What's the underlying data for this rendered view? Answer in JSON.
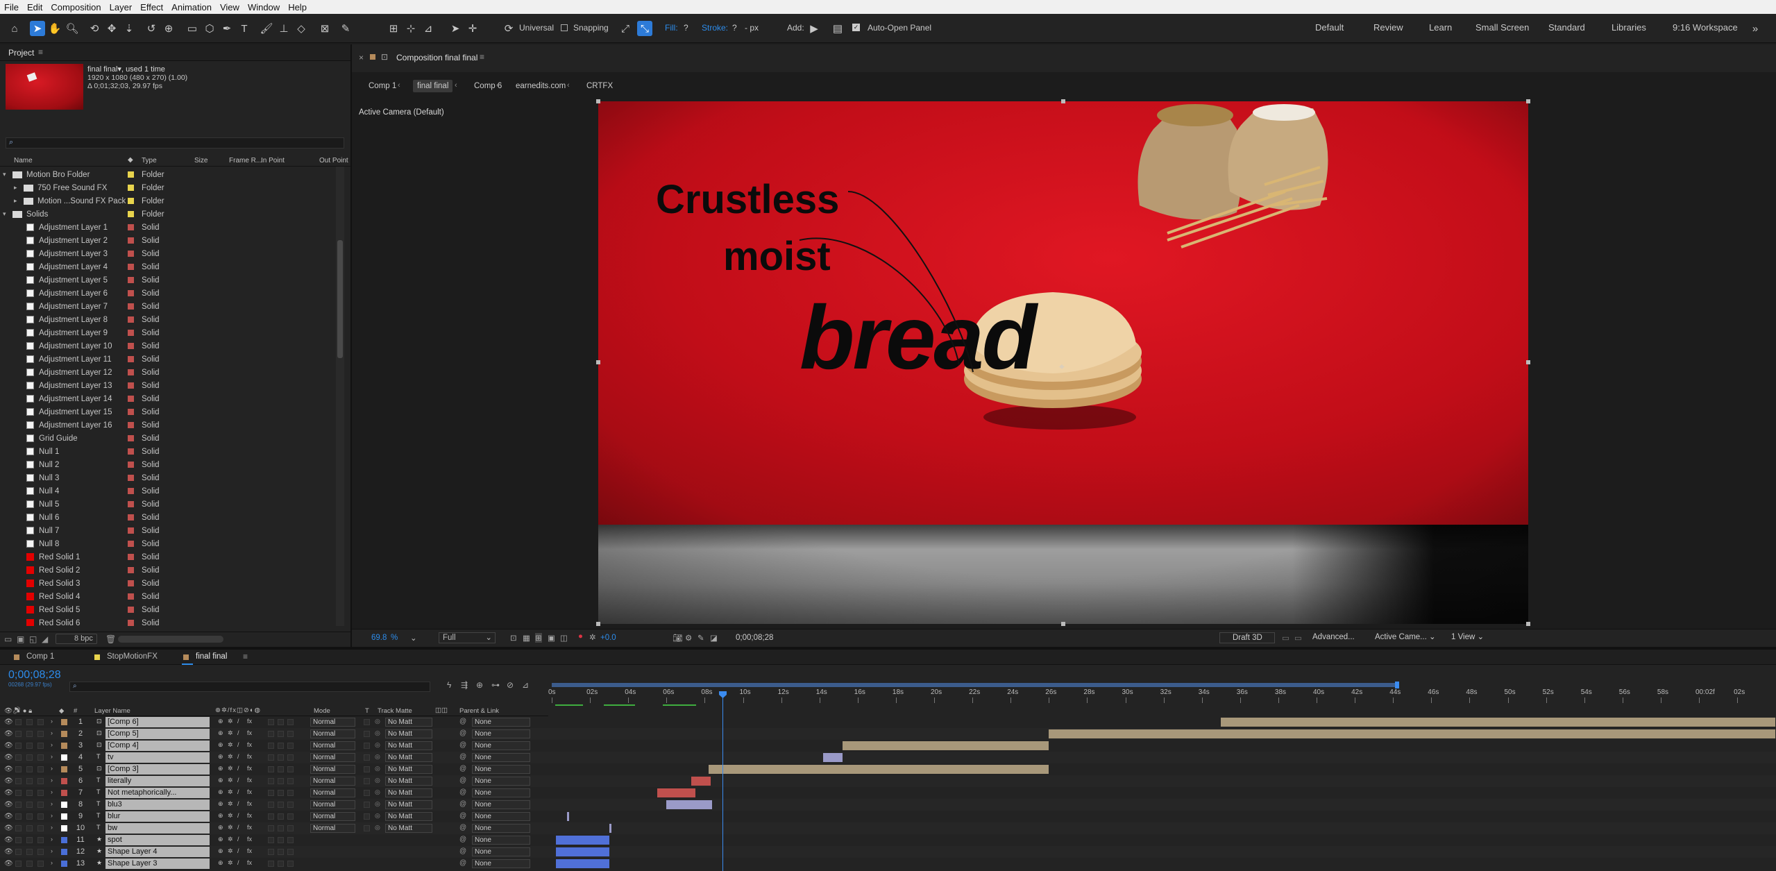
{
  "menu": [
    "File",
    "Edit",
    "Composition",
    "Layer",
    "Effect",
    "Animation",
    "View",
    "Window",
    "Help"
  ],
  "toolbar": {
    "universal": "Universal",
    "snapping": "Snapping",
    "fill_label": "Fill:",
    "fill_value": "?",
    "stroke_label": "Stroke:",
    "stroke_value": "?",
    "stroke_px": "- px",
    "add_label": "Add:",
    "auto_open": "Auto-Open Panel",
    "workspaces": [
      "Default",
      "Review",
      "Learn",
      "Small Screen",
      "Standard",
      "Libraries",
      "9:16 Workspace"
    ]
  },
  "project": {
    "tab": "Project",
    "selected_name": "final final",
    "used": ", used 1 time",
    "resolution": "1920 x 1080 (480 x 270) (1.00)",
    "duration": "Δ 0;01;32;03, 29.97 fps",
    "search_placeholder": "",
    "columns": [
      "Name",
      "Type",
      "Size",
      "Frame R...",
      "In Point",
      "Out Point"
    ],
    "bpc": "8 bpc",
    "items": [
      {
        "name": "Motion Bro Folder",
        "type": "Folder",
        "kind": "folder",
        "indent": 0,
        "color": "#e8d44d"
      },
      {
        "name": "750 Free Sound FX",
        "type": "Folder",
        "kind": "folder",
        "indent": 1,
        "color": "#e8d44d"
      },
      {
        "name": "Motion ...Sound FX Pack",
        "type": "Folder",
        "kind": "folder",
        "indent": 1,
        "color": "#e8d44d"
      },
      {
        "name": "Solids",
        "type": "Folder",
        "kind": "folder",
        "indent": 0,
        "color": "#e8d44d"
      },
      {
        "name": "Adjustment Layer 1",
        "type": "Solid",
        "kind": "white",
        "indent": 2,
        "color": "#c0504d"
      },
      {
        "name": "Adjustment Layer 2",
        "type": "Solid",
        "kind": "white",
        "indent": 2,
        "color": "#c0504d"
      },
      {
        "name": "Adjustment Layer 3",
        "type": "Solid",
        "kind": "white",
        "indent": 2,
        "color": "#c0504d"
      },
      {
        "name": "Adjustment Layer 4",
        "type": "Solid",
        "kind": "white",
        "indent": 2,
        "color": "#c0504d"
      },
      {
        "name": "Adjustment Layer 5",
        "type": "Solid",
        "kind": "white",
        "indent": 2,
        "color": "#c0504d"
      },
      {
        "name": "Adjustment Layer 6",
        "type": "Solid",
        "kind": "white",
        "indent": 2,
        "color": "#c0504d"
      },
      {
        "name": "Adjustment Layer 7",
        "type": "Solid",
        "kind": "white",
        "indent": 2,
        "color": "#c0504d"
      },
      {
        "name": "Adjustment Layer 8",
        "type": "Solid",
        "kind": "white",
        "indent": 2,
        "color": "#c0504d"
      },
      {
        "name": "Adjustment Layer 9",
        "type": "Solid",
        "kind": "white",
        "indent": 2,
        "color": "#c0504d"
      },
      {
        "name": "Adjustment Layer 10",
        "type": "Solid",
        "kind": "white",
        "indent": 2,
        "color": "#c0504d"
      },
      {
        "name": "Adjustment Layer 11",
        "type": "Solid",
        "kind": "white",
        "indent": 2,
        "color": "#c0504d"
      },
      {
        "name": "Adjustment Layer 12",
        "type": "Solid",
        "kind": "white",
        "indent": 2,
        "color": "#c0504d"
      },
      {
        "name": "Adjustment Layer 13",
        "type": "Solid",
        "kind": "white",
        "indent": 2,
        "color": "#c0504d"
      },
      {
        "name": "Adjustment Layer 14",
        "type": "Solid",
        "kind": "white",
        "indent": 2,
        "color": "#c0504d"
      },
      {
        "name": "Adjustment Layer 15",
        "type": "Solid",
        "kind": "white",
        "indent": 2,
        "color": "#c0504d"
      },
      {
        "name": "Adjustment Layer 16",
        "type": "Solid",
        "kind": "white",
        "indent": 2,
        "color": "#c0504d"
      },
      {
        "name": "Grid Guide",
        "type": "Solid",
        "kind": "white",
        "indent": 2,
        "color": "#c0504d"
      },
      {
        "name": "Null 1",
        "type": "Solid",
        "kind": "white",
        "indent": 2,
        "color": "#c0504d"
      },
      {
        "name": "Null 2",
        "type": "Solid",
        "kind": "white",
        "indent": 2,
        "color": "#c0504d"
      },
      {
        "name": "Null 3",
        "type": "Solid",
        "kind": "white",
        "indent": 2,
        "color": "#c0504d"
      },
      {
        "name": "Null 4",
        "type": "Solid",
        "kind": "white",
        "indent": 2,
        "color": "#c0504d"
      },
      {
        "name": "Null 5",
        "type": "Solid",
        "kind": "white",
        "indent": 2,
        "color": "#c0504d"
      },
      {
        "name": "Null 6",
        "type": "Solid",
        "kind": "white",
        "indent": 2,
        "color": "#c0504d"
      },
      {
        "name": "Null 7",
        "type": "Solid",
        "kind": "white",
        "indent": 2,
        "color": "#c0504d"
      },
      {
        "name": "Null 8",
        "type": "Solid",
        "kind": "white",
        "indent": 2,
        "color": "#c0504d"
      },
      {
        "name": "Red Solid 1",
        "type": "Solid",
        "kind": "red",
        "indent": 2,
        "color": "#c0504d"
      },
      {
        "name": "Red Solid 2",
        "type": "Solid",
        "kind": "red",
        "indent": 2,
        "color": "#c0504d"
      },
      {
        "name": "Red Solid 3",
        "type": "Solid",
        "kind": "red",
        "indent": 2,
        "color": "#c0504d"
      },
      {
        "name": "Red Solid 4",
        "type": "Solid",
        "kind": "red",
        "indent": 2,
        "color": "#c0504d"
      },
      {
        "name": "Red Solid 5",
        "type": "Solid",
        "kind": "red",
        "indent": 2,
        "color": "#c0504d"
      },
      {
        "name": "Red Solid 6",
        "type": "Solid",
        "kind": "red",
        "indent": 2,
        "color": "#c0504d"
      }
    ]
  },
  "comp": {
    "panel_title": "Composition final final",
    "breadcrumbs": [
      "Comp 1",
      "final final",
      "Comp 6",
      "earnedits.com",
      "CRTFX"
    ],
    "camera": "Active Camera (Default)",
    "overlay": {
      "line1": "Crustless",
      "line2": "moist",
      "line3": "bread"
    },
    "zoom": "69.8",
    "zoom_unit": "%",
    "resolution": "Full",
    "exposure": "+0.0",
    "timecode": "0;00;08;28",
    "renderer": "Draft 3D",
    "advanced": "Advanced...",
    "camera_select": "Active Came...",
    "views": "1 View"
  },
  "timeline": {
    "tabs": [
      {
        "label": "Comp 1",
        "color": "#b58b5b"
      },
      {
        "label": "StopMotionFX",
        "color": "#e8d44d"
      },
      {
        "label": "final final",
        "color": "#b58b5b"
      }
    ],
    "timecode": "0;00;08;28",
    "frames": "00268 (29.97 fps)",
    "search_placeholder": "",
    "headers": {
      "layer_name": "Layer Name",
      "mode": "Mode",
      "t": "T",
      "track_matte": "Track Matte",
      "parent": "Parent & Link",
      "num": "#"
    },
    "ruler": [
      "0s",
      "02s",
      "04s",
      "06s",
      "08s",
      "10s",
      "12s",
      "14s",
      "16s",
      "18s",
      "20s",
      "22s",
      "24s",
      "26s",
      "28s",
      "30s",
      "32s",
      "34s",
      "36s",
      "38s",
      "40s",
      "42s",
      "44s",
      "46s",
      "48s",
      "50s",
      "52s",
      "54s",
      "56s",
      "58s",
      "00:02f",
      "02s"
    ],
    "layers": [
      {
        "n": "1",
        "name": "[Comp 6]",
        "color": "#b58b5b",
        "mode": "Normal",
        "matte": "No Matt",
        "parent": "None",
        "bar_color": "#a8987a",
        "start": 35,
        "end": 64
      },
      {
        "n": "2",
        "name": "[Comp 5]",
        "color": "#b58b5b",
        "mode": "Normal",
        "matte": "No Matt",
        "parent": "None",
        "bar_color": "#a8987a",
        "start": 26,
        "end": 64
      },
      {
        "n": "3",
        "name": "[Comp 4]",
        "color": "#b58b5b",
        "mode": "Normal",
        "matte": "No Matt",
        "parent": "None",
        "bar_color": "#a8987a",
        "start": 15.2,
        "end": 26
      },
      {
        "n": "4",
        "name": "tv",
        "color": "#ffffff",
        "mode": "Normal",
        "matte": "No Matt",
        "parent": "None",
        "bar_color": "#9a9ac8",
        "start": 14.2,
        "end": 15.2
      },
      {
        "n": "5",
        "name": "[Comp 3]",
        "color": "#b58b5b",
        "mode": "Normal",
        "matte": "No Matt",
        "parent": "None",
        "bar_color": "#a8987a",
        "start": 8.2,
        "end": 26
      },
      {
        "n": "6",
        "name": "literally",
        "color": "#c0504d",
        "mode": "Normal",
        "matte": "No Matt",
        "parent": "None",
        "bar_color": "#c0504d",
        "start": 7.3,
        "end": 8.3
      },
      {
        "n": "7",
        "name": "Not metaphorically...",
        "color": "#c0504d",
        "mode": "Normal",
        "matte": "No Matt",
        "parent": "None",
        "bar_color": "#c0504d",
        "start": 5.5,
        "end": 7.5
      },
      {
        "n": "8",
        "name": "blu3",
        "color": "#ffffff",
        "mode": "Normal",
        "matte": "No Matt",
        "parent": "None",
        "bar_color": "#9a9ac8",
        "start": 6.0,
        "end": 8.4
      },
      {
        "n": "9",
        "name": "blur",
        "color": "#ffffff",
        "mode": "Normal",
        "matte": "No Matt",
        "parent": "None",
        "bar_color": "#9a9ac8",
        "start": 0.8,
        "end": 0.9
      },
      {
        "n": "10",
        "name": "bw",
        "color": "#ffffff",
        "mode": "Normal",
        "matte": "No Matt",
        "parent": "None",
        "bar_color": "#9a9ac8",
        "start": 3.0,
        "end": 3.1
      },
      {
        "n": "11",
        "name": "spot",
        "color": "#4a6fd8",
        "mode": "",
        "matte": "",
        "parent": "None",
        "bar_color": "#5070d8",
        "start": 0.2,
        "end": 3.0
      },
      {
        "n": "12",
        "name": "Shape Layer 4",
        "color": "#4a6fd8",
        "mode": "",
        "matte": "",
        "parent": "None",
        "bar_color": "#5070d8",
        "start": 0.2,
        "end": 3.0
      },
      {
        "n": "13",
        "name": "Shape Layer 3",
        "color": "#4a6fd8",
        "mode": "",
        "matte": "",
        "parent": "None",
        "bar_color": "#5070d8",
        "start": 0.2,
        "end": 3.0
      }
    ],
    "playhead_seconds": 8.93,
    "work_area_end_seconds": 44.2,
    "seconds_per_ruler_unit": 2
  }
}
